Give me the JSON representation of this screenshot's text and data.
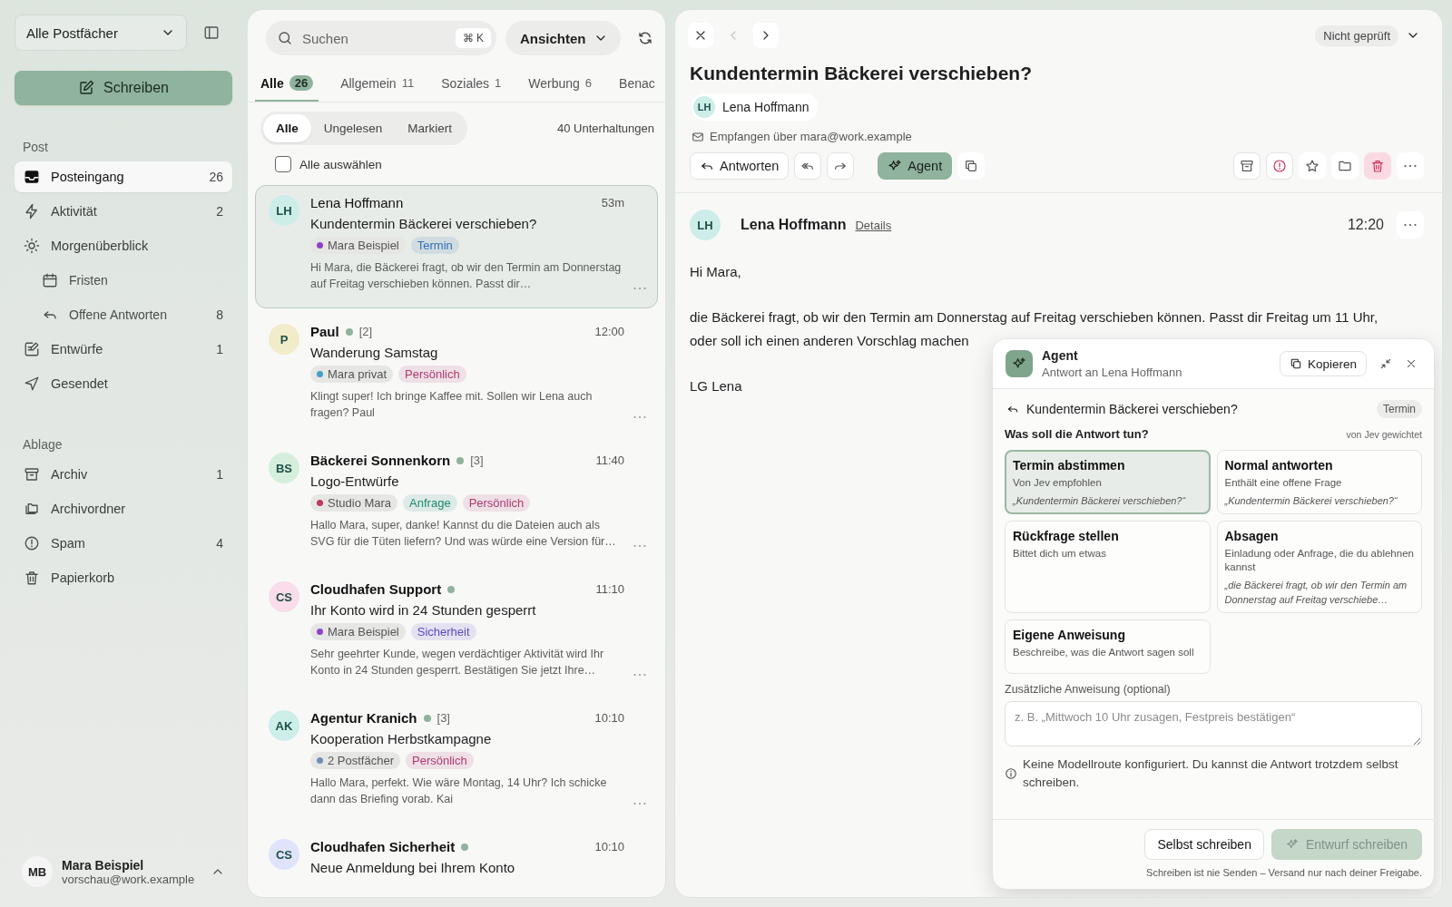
{
  "sidebar": {
    "mailbox": "Alle Postfächer",
    "compose": "Schreiben",
    "sections": [
      {
        "title": "Post",
        "items": [
          {
            "label": "Posteingang",
            "count": "26",
            "selected": true
          },
          {
            "label": "Aktivität",
            "count": "2",
            "selected": false
          },
          {
            "label": "Morgenüberblick",
            "selected": false,
            "children": [
              {
                "label": "Fristen",
                "selected": false
              },
              {
                "label": "Offene Antworten",
                "count": "8",
                "selected": false
              }
            ]
          },
          {
            "label": "Entwürfe",
            "count": "1",
            "selected": false
          },
          {
            "label": "Gesendet",
            "selected": false
          }
        ]
      },
      {
        "title": "Ablage",
        "items": [
          {
            "label": "Archiv",
            "count": "1",
            "selected": false
          },
          {
            "label": "Archivordner",
            "selected": false
          },
          {
            "label": "Spam",
            "count": "4",
            "selected": false
          },
          {
            "label": "Papierkorb",
            "selected": false
          }
        ]
      }
    ]
  },
  "account": {
    "initials": "MB",
    "name": "Mara Beispiel",
    "email": "vorschau@work.example"
  },
  "list": {
    "search": {
      "placeholder": "Suchen",
      "shortcut": "⌘ K"
    },
    "views": "Ansichten",
    "tabs": [
      {
        "label": "Alle",
        "count": "26",
        "selected": true
      },
      {
        "label": "Allgemein",
        "count": "11",
        "selected": false
      },
      {
        "label": "Soziales",
        "count": "1",
        "selected": false
      },
      {
        "label": "Werbung",
        "count": "6",
        "selected": false
      },
      {
        "label": "Benac",
        "selected": false
      }
    ],
    "filters": [
      {
        "label": "Alle",
        "selected": true
      },
      {
        "label": "Ungelesen",
        "selected": false
      },
      {
        "label": "Markiert",
        "selected": false
      }
    ],
    "total": "40 Unterhaltungen",
    "select_all": {
      "label": "Alle auswählen",
      "checked": false
    },
    "messages": [
      {
        "initials": "LH",
        "color": "#cdeee8",
        "sender": "Lena Hoffmann",
        "unread": false,
        "time": "53m",
        "subject": "Kundentermin Bäckerei verschieben?",
        "tags": [
          {
            "kind": "account",
            "label": "Mara Beispiel",
            "color": "#8e44c8"
          },
          {
            "kind": "label",
            "label": "Termin",
            "color": "#2f6fb5"
          }
        ],
        "preview": "Hi Mara, die Bäckerei fragt, ob wir den Termin am Donnerstag auf Freitag verschieben können. Passt dir…",
        "selected": true
      },
      {
        "initials": "P",
        "color": "#f1ecc9",
        "sender": "Paul",
        "unread": true,
        "thread": "[2]",
        "time": "12:00",
        "subject": "Wanderung Samstag",
        "tags": [
          {
            "kind": "account",
            "label": "Mara privat",
            "color": "#3fa3c4"
          },
          {
            "kind": "label",
            "label": "Persönlich",
            "color": "#b03a6e"
          }
        ],
        "preview": "Klingt super! Ich bringe Kaffee mit. Sollen wir Lena auch fragen? Paul",
        "selected": false
      },
      {
        "initials": "BS",
        "color": "#d6efdc",
        "sender": "Bäckerei Sonnenkorn",
        "unread": true,
        "thread": "[3]",
        "time": "11:40",
        "subject": "Logo-Entwürfe",
        "tags": [
          {
            "kind": "account",
            "label": "Studio Mara",
            "color": "#c0395a"
          },
          {
            "kind": "label",
            "label": "Anfrage",
            "color": "#1f8a70"
          },
          {
            "kind": "label",
            "label": "Persönlich",
            "color": "#b03a6e"
          }
        ],
        "preview": "Hallo Mara, super, danke! Kannst du die Dateien auch als SVG für die Tüten liefern? Und was würde eine Version für…",
        "selected": false
      },
      {
        "initials": "CS",
        "color": "#fadcea",
        "sender": "Cloudhafen Support",
        "unread": true,
        "time": "11:10",
        "subject": "Ihr Konto wird in 24 Stunden gesperrt",
        "tags": [
          {
            "kind": "account",
            "label": "Mara Beispiel",
            "color": "#8e44c8"
          },
          {
            "kind": "label",
            "label": "Sicherheit",
            "color": "#5b4bc4"
          }
        ],
        "preview": "Sehr geehrter Kunde, wegen verdächtiger Aktivität wird Ihr Konto in 24 Stunden gesperrt. Bestätigen Sie jetzt Ihre…",
        "selected": false
      },
      {
        "initials": "AK",
        "color": "#cdeee9",
        "sender": "Agentur Kranich",
        "unread": true,
        "thread": "[3]",
        "time": "10:10",
        "subject": "Kooperation Herbstkampagne",
        "tags": [
          {
            "kind": "account",
            "label": "2 Postfächer",
            "color": "#6f8fb8"
          },
          {
            "kind": "label",
            "label": "Persönlich",
            "color": "#b03a6e"
          }
        ],
        "preview": "Hallo Mara, perfekt. Wie wäre Montag, 14 Uhr? Ich schicke dann das Briefing vorab. Kai",
        "selected": false
      },
      {
        "initials": "CS",
        "color": "#dfe4fb",
        "sender": "Cloudhafen Sicherheit",
        "unread": true,
        "time": "10:10",
        "subject": "Neue Anmeldung bei Ihrem Konto",
        "selected": false
      }
    ]
  },
  "reader": {
    "previous_disabled": true,
    "status": "Nicht geprüft",
    "title": "Kundentermin Bäckerei verschieben?",
    "sender": {
      "initials": "LH",
      "name": "Lena Hoffmann"
    },
    "received": "Empfangen über mara@work.example",
    "reply": "Antworten",
    "agent": {
      "label": "Agent",
      "active": true
    },
    "message": {
      "initials": "LH",
      "sender": "Lena Hoffmann",
      "details": "Details",
      "time": "12:20",
      "lines": [
        "Hi Mara,",
        "die Bäckerei fragt, ob wir den Termin am Donnerstag auf Freitag verschieben können. Passt dir Freitag um 11 Uhr,",
        "oder soll ich einen anderen Vorschlag machen",
        "LG Lena"
      ]
    }
  },
  "agent": {
    "title": "Agent",
    "subtitle": "Antwort an Lena Hoffmann",
    "copy": "Kopieren",
    "subject": "Kundentermin Bäckerei verschieben?",
    "tag": "Termin",
    "question": "Was soll die Antwort tun?",
    "note": "von Jev gewichtet",
    "options": [
      {
        "title": "Termin abstimmen",
        "description": "Von Jev empfohlen",
        "quote": "„Kundentermin Bäckerei verschieben?“",
        "selected": true
      },
      {
        "title": "Normal antworten",
        "description": "Enthält eine offene Frage",
        "quote": "„Kundentermin Bäckerei verschieben?“",
        "selected": false
      },
      {
        "title": "Rückfrage stellen",
        "description": "Bittet dich um etwas",
        "selected": false
      },
      {
        "title": "Absagen",
        "description": "Einladung oder Anfrage, die du ablehnen kannst",
        "quote": "„die Bäckerei fragt, ob wir den Termin am Donnerstag auf Freitag verschiebe…",
        "selected": false
      },
      {
        "title": "Eigene Anweisung",
        "description": "Beschreibe, was die Antwort sagen soll",
        "selected": false
      }
    ],
    "extra_label": "Zusätzliche Anweisung (optional)",
    "extra_placeholder": "z. B. „Mittwoch 10 Uhr zusagen, Festpreis bestätigen“",
    "info": "Keine Modellroute konfiguriert. Du kannst die Antwort trotzdem selbst schreiben.",
    "self_write": "Selbst schreiben",
    "draft": {
      "label": "Entwurf schreiben",
      "disabled": true
    },
    "footer": "Schreiben ist nie Senden – Versand nur nach deiner Freigabe."
  }
}
